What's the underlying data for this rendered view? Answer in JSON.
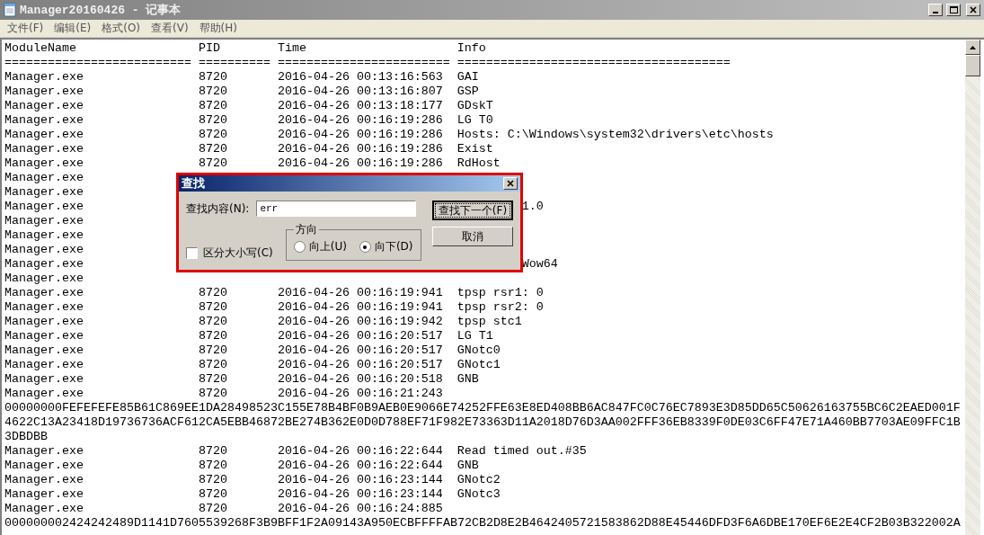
{
  "window": {
    "title": "Manager20160426 - 记事本"
  },
  "menu": [
    "文件(F)",
    "编辑(E)",
    "格式(O)",
    "查看(V)",
    "帮助(H)"
  ],
  "header": {
    "columns": [
      "ModuleName",
      "PID",
      "Time",
      "Info"
    ],
    "separators": [
      "==========================",
      "==========",
      "========================",
      "======================================"
    ]
  },
  "lines": [
    {
      "kind": "entry",
      "module": "Manager.exe",
      "pid": "8720",
      "time": "2016-04-26 00:13:16:563",
      "info": "GAI"
    },
    {
      "kind": "entry",
      "module": "Manager.exe",
      "pid": "8720",
      "time": "2016-04-26 00:13:16:807",
      "info": "GSP"
    },
    {
      "kind": "entry",
      "module": "Manager.exe",
      "pid": "8720",
      "time": "2016-04-26 00:13:18:177",
      "info": "GDskT"
    },
    {
      "kind": "entry",
      "module": "Manager.exe",
      "pid": "8720",
      "time": "2016-04-26 00:16:19:286",
      "info": "LG T0"
    },
    {
      "kind": "entry",
      "module": "Manager.exe",
      "pid": "8720",
      "time": "2016-04-26 00:16:19:286",
      "info": "Hosts: C:\\Windows\\system32\\drivers\\etc\\hosts"
    },
    {
      "kind": "entry",
      "module": "Manager.exe",
      "pid": "8720",
      "time": "2016-04-26 00:16:19:286",
      "info": "Exist"
    },
    {
      "kind": "entry",
      "module": "Manager.exe",
      "pid": "8720",
      "time": "2016-04-26 00:16:19:286",
      "info": "RdHost"
    },
    {
      "kind": "covered",
      "module": "Manager.exe"
    },
    {
      "kind": "covered",
      "module": "Manager.exe"
    },
    {
      "kind": "covered",
      "module": "Manager.exe",
      "tail": "1.0"
    },
    {
      "kind": "covered",
      "module": "Manager.exe"
    },
    {
      "kind": "covered",
      "module": "Manager.exe"
    },
    {
      "kind": "covered",
      "module": "Manager.exe"
    },
    {
      "kind": "covered",
      "module": "Manager.exe",
      "tail": "Wow64"
    },
    {
      "kind": "covered",
      "module": "Manager.exe"
    },
    {
      "kind": "entry",
      "module": "Manager.exe",
      "pid": "8720",
      "time": "2016-04-26 00:16:19:941",
      "info": "tpsp rsr1: 0"
    },
    {
      "kind": "entry",
      "module": "Manager.exe",
      "pid": "8720",
      "time": "2016-04-26 00:16:19:941",
      "info": "tpsp rsr2: 0"
    },
    {
      "kind": "entry",
      "module": "Manager.exe",
      "pid": "8720",
      "time": "2016-04-26 00:16:19:942",
      "info": "tpsp stc1"
    },
    {
      "kind": "entry",
      "module": "Manager.exe",
      "pid": "8720",
      "time": "2016-04-26 00:16:20:517",
      "info": "LG T1"
    },
    {
      "kind": "entry",
      "module": "Manager.exe",
      "pid": "8720",
      "time": "2016-04-26 00:16:20:517",
      "info": "GNotc0"
    },
    {
      "kind": "entry",
      "module": "Manager.exe",
      "pid": "8720",
      "time": "2016-04-26 00:16:20:517",
      "info": "GNotc1"
    },
    {
      "kind": "entry",
      "module": "Manager.exe",
      "pid": "8720",
      "time": "2016-04-26 00:16:20:518",
      "info": "GNB"
    },
    {
      "kind": "entry",
      "module": "Manager.exe",
      "pid": "8720",
      "time": "2016-04-26 00:16:21:243"
    },
    {
      "kind": "text",
      "text": "00000000FEFEFEFE85B61C869EE1DA28498523C155E78B4BF0B9AEB0E9066E74252FFE63E8ED408BB6AC847FC0C76EC7893E3D85DD65C50626163755BC6C2EAED001F"
    },
    {
      "kind": "text",
      "text": "4622C13A23418D19736736ACF612CA5EBB46872BE274B362E0D0D788EF71F982E73363D11A2018D76D3AA002FFF36EB8339F0DE03C6FF47E71A460BB7703AE09FFC1B"
    },
    {
      "kind": "text",
      "text": "3DBDBB"
    },
    {
      "kind": "entry",
      "module": "Manager.exe",
      "pid": "8720",
      "time": "2016-04-26 00:16:22:644",
      "info": "Read timed out.#35"
    },
    {
      "kind": "entry",
      "module": "Manager.exe",
      "pid": "8720",
      "time": "2016-04-26 00:16:22:644",
      "info": "GNB"
    },
    {
      "kind": "entry",
      "module": "Manager.exe",
      "pid": "8720",
      "time": "2016-04-26 00:16:23:144",
      "info": "GNotc2"
    },
    {
      "kind": "entry",
      "module": "Manager.exe",
      "pid": "8720",
      "time": "2016-04-26 00:16:23:144",
      "info": "GNotc3"
    },
    {
      "kind": "entry",
      "module": "Manager.exe",
      "pid": "8720",
      "time": "2016-04-26 00:16:24:885"
    },
    {
      "kind": "text",
      "text": "000000002424242489D1141D7605539268F3B9BFF1F2A09143A950ECBFFFFAB72CB2D8E2B4642405721583862D88E45446DFD3F6A6DBE170EF6E2E4CF2B03B322002A"
    }
  ],
  "find_dialog": {
    "title": "查找",
    "label": "查找内容(N):",
    "value": "err",
    "find_next": "查找下一个(F)",
    "cancel": "取消",
    "match_case": {
      "label": "区分大小写(C)",
      "checked": false
    },
    "direction": {
      "label": "方向",
      "options": [
        {
          "label": "向上(U)",
          "selected": false
        },
        {
          "label": "向下(D)",
          "selected": true
        }
      ]
    }
  }
}
